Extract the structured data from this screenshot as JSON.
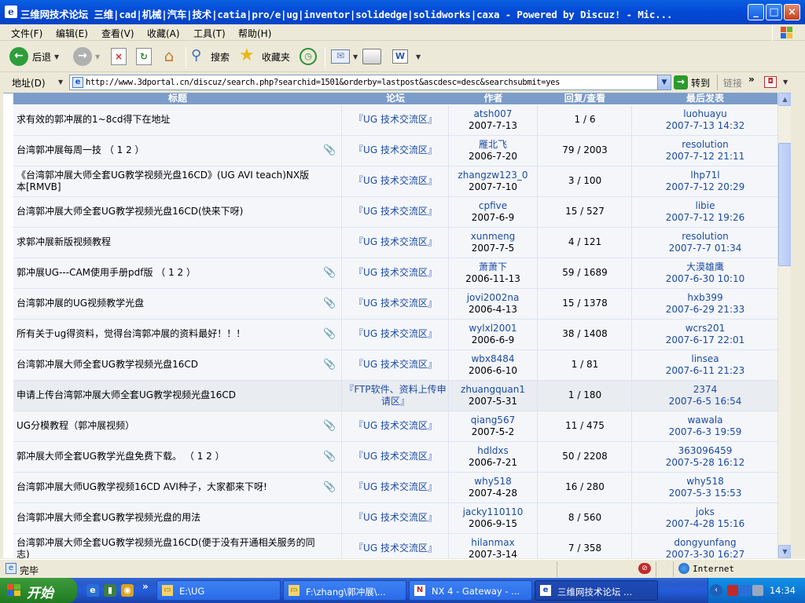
{
  "window": {
    "title": "三维网技术论坛 三维|cad|机械|汽车|技术|catia|pro/e|ug|inventor|solidedge|solidworks|caxa - Powered by Discuz! - Mic...",
    "minimize": "_",
    "maximize": "□",
    "close": "×"
  },
  "menu": [
    "文件(F)",
    "编辑(E)",
    "查看(V)",
    "收藏(A)",
    "工具(T)",
    "帮助(H)"
  ],
  "toolbar": {
    "back": "后退",
    "search": "搜索",
    "favorites": "收藏夹"
  },
  "address": {
    "label": "地址(D)",
    "url": "http://www.3dportal.cn/discuz/search.php?searchid=1501&orderby=lastpost&ascdesc=desc&searchsubmit=yes",
    "go": "转到",
    "links": "链接"
  },
  "table": {
    "headers": [
      "标题",
      "论坛",
      "作者",
      "回复/查看",
      "最后发表"
    ],
    "rows": [
      {
        "title": "求有效的郭冲展的1~8cd得下在地址",
        "forum": "『UG 技术交流区』",
        "author": "atsh007",
        "date": "2007-7-13",
        "replies": "1 / 6",
        "last_user": "luohuayu",
        "last_time": "2007-7-13 14:32",
        "attach": false
      },
      {
        "title": "台湾郭冲展每周一技 （ 1 2 ）",
        "forum": "『UG 技术交流区』",
        "author": "雁北飞",
        "date": "2006-7-20",
        "replies": "79 / 2003",
        "last_user": "resolution",
        "last_time": "2007-7-12 21:11",
        "attach": true
      },
      {
        "title": "《台湾郭冲展大师全套UG教学视频光盘16CD》(UG AVI teach)NX版本[RMVB]",
        "forum": "『UG 技术交流区』",
        "author": "zhangzw123_0",
        "date": "2007-7-10",
        "replies": "3 / 100",
        "last_user": "lhp71l",
        "last_time": "2007-7-12 20:29",
        "attach": false
      },
      {
        "title": "台湾郭冲展大师全套UG教学视频光盘16CD(快来下呀)",
        "forum": "『UG 技术交流区』",
        "author": "cpfive",
        "date": "2007-6-9",
        "replies": "15 / 527",
        "last_user": "libie",
        "last_time": "2007-7-12 19:26",
        "attach": false
      },
      {
        "title": "求郭冲展新版视频教程",
        "forum": "『UG 技术交流区』",
        "author": "xunmeng",
        "date": "2007-7-5",
        "replies": "4 / 121",
        "last_user": "resolution",
        "last_time": "2007-7-7 01:34",
        "attach": false
      },
      {
        "title": "郭冲展UG---CAM使用手册pdf版 （ 1 2 ）",
        "forum": "『UG 技术交流区』",
        "author": "萧萧下",
        "date": "2006-11-13",
        "replies": "59 / 1689",
        "last_user": "大漠雄鹰",
        "last_time": "2007-6-30 10:10",
        "attach": true
      },
      {
        "title": "台湾郭冲展的UG视频教学光盘",
        "forum": "『UG 技术交流区』",
        "author": "jovi2002na",
        "date": "2006-4-13",
        "replies": "15 / 1378",
        "last_user": "hxb399",
        "last_time": "2007-6-29 21:33",
        "attach": true
      },
      {
        "title": "所有关于ug得资料，觉得台湾郭冲展的资料最好！！！",
        "forum": "『UG 技术交流区』",
        "author": "wylxl2001",
        "date": "2006-6-9",
        "replies": "38 / 1408",
        "last_user": "wcrs201",
        "last_time": "2007-6-17 22:01",
        "attach": true
      },
      {
        "title": "台湾郭冲展大师全套UG教学视频光盘16CD",
        "forum": "『UG 技术交流区』",
        "author": "wbx8484",
        "date": "2006-6-10",
        "replies": "1 / 81",
        "last_user": "linsea",
        "last_time": "2007-6-11 21:23",
        "attach": true
      },
      {
        "title": "申请上传台湾郭冲展大师全套UG教学视频光盘16CD",
        "forum": "『FTP软件、资料上传申请区』",
        "author": "zhuangquan1",
        "date": "2007-5-31",
        "replies": "1 / 180",
        "last_user": "2374",
        "last_time": "2007-6-5 16:54",
        "attach": false
      },
      {
        "title": "UG分模教程（郭冲展视频）",
        "forum": "『UG 技术交流区』",
        "author": "qiang567",
        "date": "2007-5-2",
        "replies": "11 / 475",
        "last_user": "wawala",
        "last_time": "2007-6-3 19:59",
        "attach": true
      },
      {
        "title": "郭冲展大师全套UG教学光盘免费下载。 （ 1 2 ）",
        "forum": "『UG 技术交流区』",
        "author": "hdldxs",
        "date": "2006-7-21",
        "replies": "50 / 2208",
        "last_user": "363096459",
        "last_time": "2007-5-28 16:12",
        "attach": true
      },
      {
        "title": "台湾郭冲展大师UG教学视频16CD AVI种子，大家都来下呀!",
        "forum": "『UG 技术交流区』",
        "author": "why518",
        "date": "2007-4-28",
        "replies": "16 / 280",
        "last_user": "why518",
        "last_time": "2007-5-3 15:53",
        "attach": true
      },
      {
        "title": "台湾郭冲展大师全套UG教学视频光盘的用法",
        "forum": "『UG 技术交流区』",
        "author": "jacky110110",
        "date": "2006-9-15",
        "replies": "8 / 560",
        "last_user": "joks",
        "last_time": "2007-4-28 15:16",
        "attach": false
      },
      {
        "title": "台湾郭冲展大师全套UG教学视频光盘16CD(便于没有开通相关服务的同志)",
        "forum": "『UG 技术交流区』",
        "author": "hilanmax",
        "date": "2007-3-14",
        "replies": "7 / 358",
        "last_user": "dongyunfang",
        "last_time": "2007-3-30 16:27",
        "attach": false
      }
    ]
  },
  "status": {
    "text": "完毕",
    "zone": "Internet"
  },
  "taskbar": {
    "start": "开始",
    "tasks": [
      "E:\\UG",
      "F:\\zhang\\郭冲展\\...",
      "NX 4 - Gateway - ...",
      "三维网技术论坛 ..."
    ],
    "clock": "14:34"
  }
}
